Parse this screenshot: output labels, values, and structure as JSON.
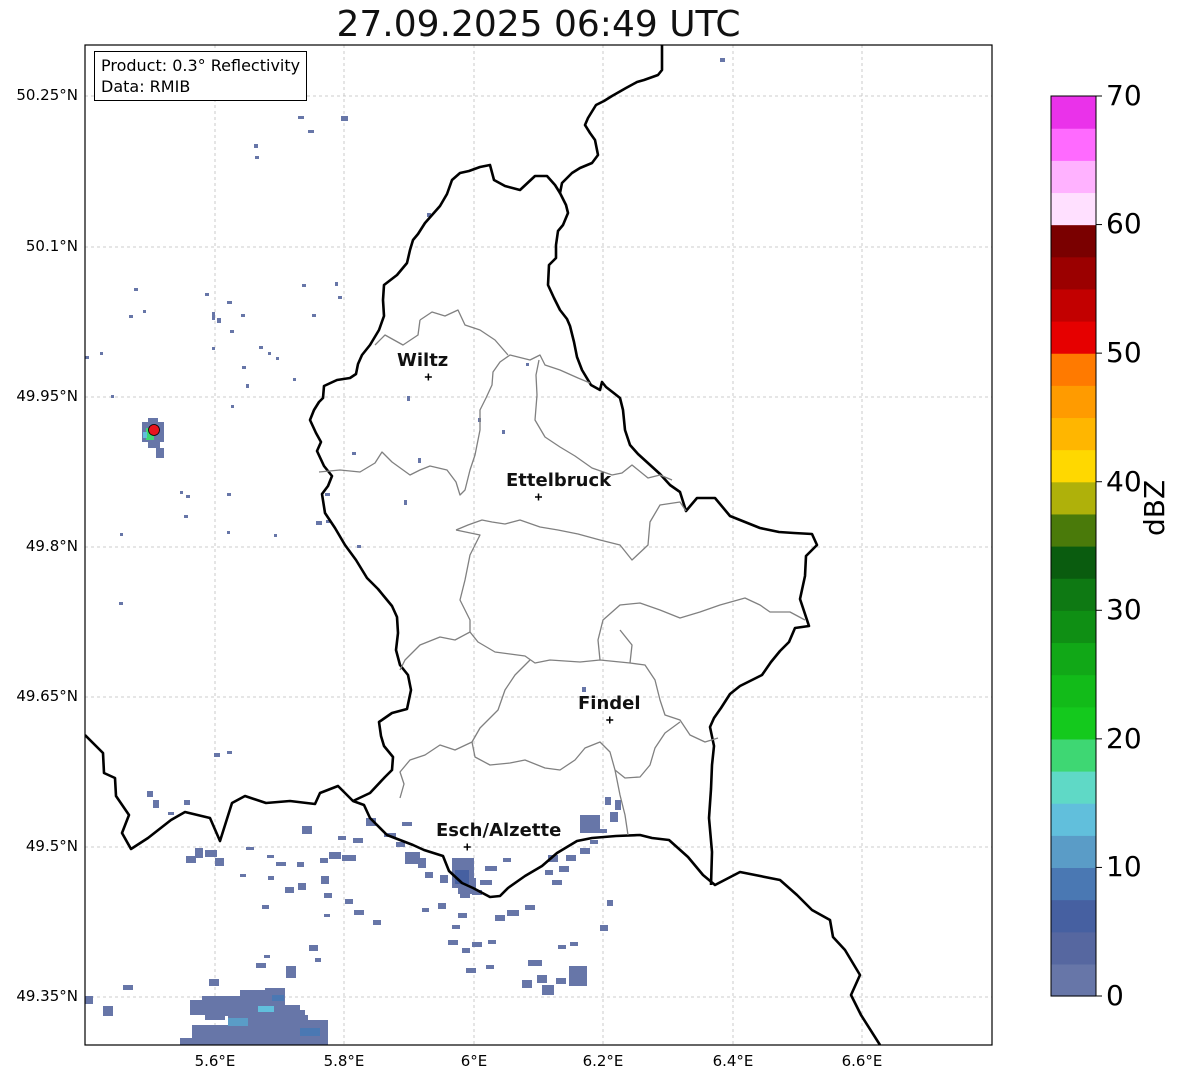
{
  "title": "27.09.2025 06:49 UTC",
  "info_box": {
    "product": "Product: 0.3° Reflectivity",
    "data_source": "Data: RMIB"
  },
  "axes": {
    "lat_labels": [
      "50.25°N",
      "50.1°N",
      "49.95°N",
      "49.8°N",
      "49.65°N",
      "49.5°N",
      "49.35°N"
    ],
    "lon_labels": [
      "5.6°E",
      "5.8°E",
      "6°E",
      "6.2°E",
      "6.4°E",
      "6.6°E"
    ],
    "lon_range": [
      5.4,
      6.8
    ],
    "lat_range": [
      49.3,
      50.3
    ],
    "grid": true
  },
  "cities": [
    {
      "name": "Wiltz",
      "lon": 5.93,
      "lat": 49.968
    },
    {
      "name": "Ettelbruck",
      "lon": 6.1,
      "lat": 49.848
    },
    {
      "name": "Findel",
      "lon": 6.21,
      "lat": 49.625
    },
    {
      "name": "Esch/Alzette",
      "lon": 5.99,
      "lat": 49.498
    }
  ],
  "radar_site": {
    "lon": 5.506,
    "lat": 49.915,
    "color": "#e8141e"
  },
  "colorbar": {
    "label": "dBZ",
    "min": 0,
    "max": 70,
    "ticks": [
      "0",
      "10",
      "20",
      "30",
      "40",
      "50",
      "60",
      "70"
    ],
    "colors": [
      "#6776a8",
      "#5667a0",
      "#4660a1",
      "#4a78b3",
      "#5a9cc7",
      "#61bfdc",
      "#5fd9c6",
      "#3ed773",
      "#14c91d",
      "#12bb19",
      "#11a817",
      "#0f8f14",
      "#0e7913",
      "#0a5c0f",
      "#4a7a0a",
      "#afb10a",
      "#ffd800",
      "#ffb600",
      "#ff9b00",
      "#ff7a00",
      "#e60000",
      "#c20000",
      "#9b0000",
      "#7a0000",
      "#ffe0ff",
      "#ffb2ff",
      "#ff6aff",
      "#ea32ea"
    ]
  }
}
